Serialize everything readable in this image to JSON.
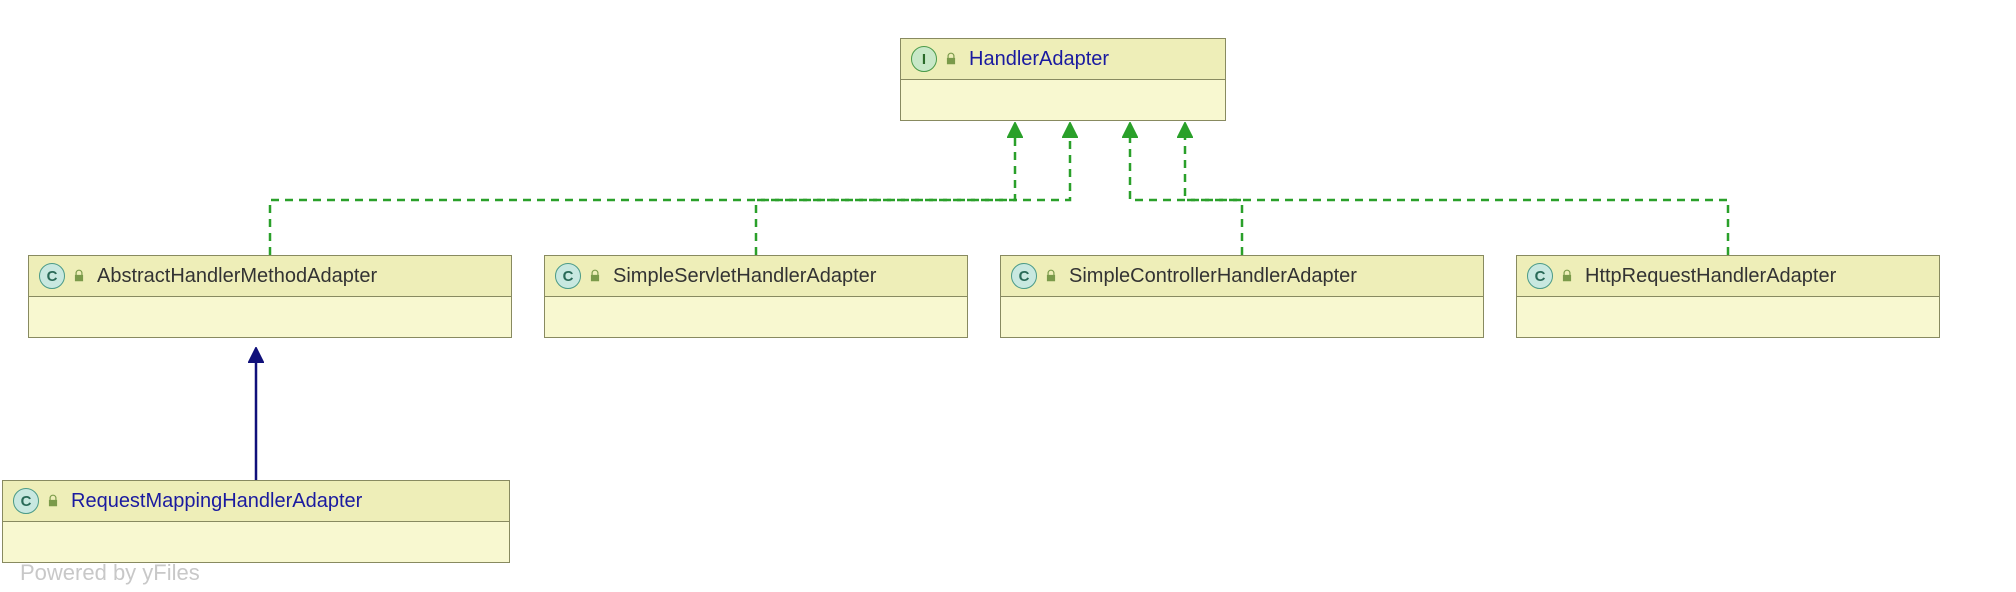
{
  "footer": "Powered by yFiles",
  "icons": {
    "class_letter": "C",
    "interface_letter": "I"
  },
  "nodes": {
    "handlerAdapter": {
      "kind": "interface",
      "name": "HandlerAdapter"
    },
    "abstractHandlerMethodAdapter": {
      "kind": "class",
      "name": "AbstractHandlerMethodAdapter"
    },
    "simpleServletHandlerAdapter": {
      "kind": "class",
      "name": "SimpleServletHandlerAdapter"
    },
    "simpleControllerHandlerAdapter": {
      "kind": "class",
      "name": "SimpleControllerHandlerAdapter"
    },
    "httpRequestHandlerAdapter": {
      "kind": "class",
      "name": "HttpRequestHandlerAdapter"
    },
    "requestMappingHandlerAdapter": {
      "kind": "class",
      "name": "RequestMappingHandlerAdapter"
    }
  },
  "edges": [
    {
      "from": "abstractHandlerMethodAdapter",
      "to": "handlerAdapter",
      "style": "dashed-green"
    },
    {
      "from": "simpleServletHandlerAdapter",
      "to": "handlerAdapter",
      "style": "dashed-green"
    },
    {
      "from": "simpleControllerHandlerAdapter",
      "to": "handlerAdapter",
      "style": "dashed-green"
    },
    {
      "from": "httpRequestHandlerAdapter",
      "to": "handlerAdapter",
      "style": "dashed-green"
    },
    {
      "from": "requestMappingHandlerAdapter",
      "to": "abstractHandlerMethodAdapter",
      "style": "solid-navy"
    }
  ]
}
